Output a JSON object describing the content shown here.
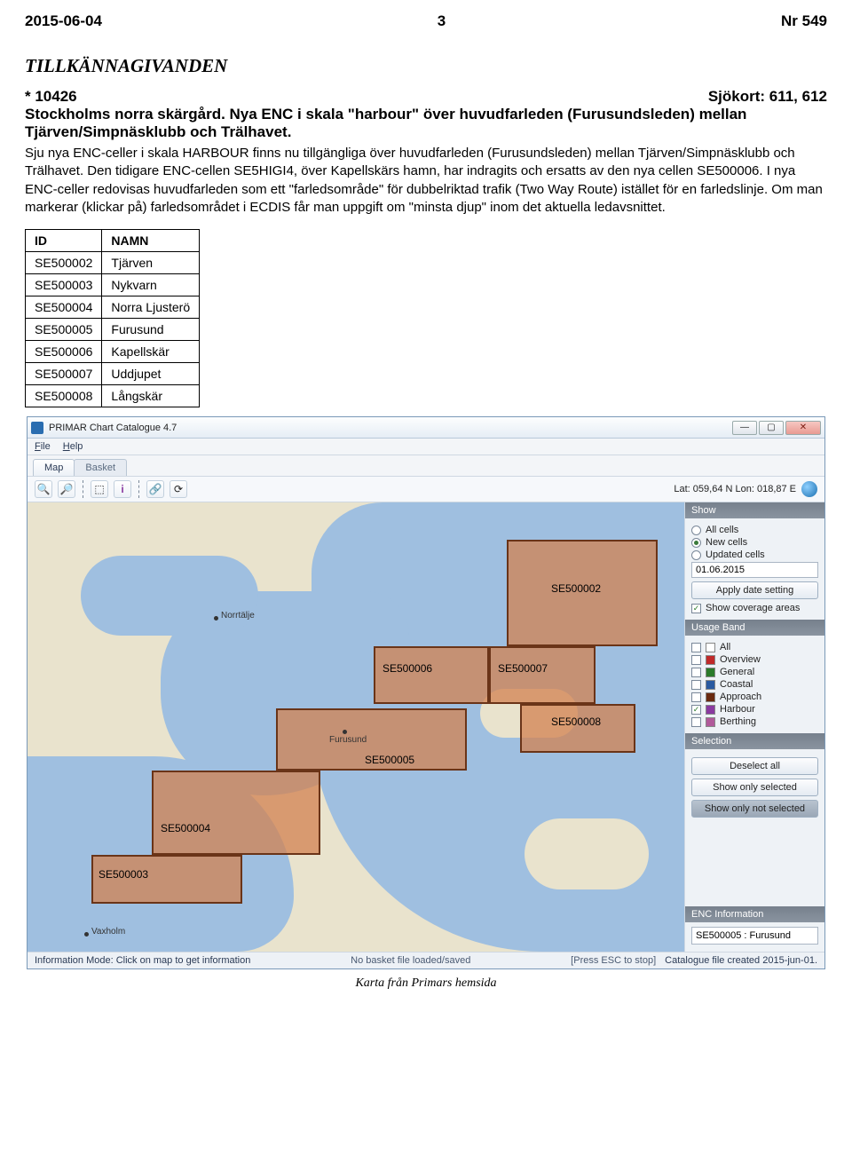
{
  "header": {
    "date": "2015-06-04",
    "page": "3",
    "issue": "Nr 549"
  },
  "section_title": "TILLKÄNNAGIVANDEN",
  "notice": {
    "id": "* 10426",
    "chart_ref": "Sjökort: 611, 612",
    "subtitle": "Stockholms norra skärgård. Nya ENC i skala \"harbour\" över huvudfarleden (Furusundsleden) mellan Tjärven/Simpnäsklubb och Trälhavet.",
    "body": "Sju nya ENC-celler i skala HARBOUR finns nu tillgängliga över huvudfarleden (Furusundsleden) mellan Tjärven/Simpnäsklubb och Trälhavet. Den tidigare ENC-cellen SE5HIGI4, över Kapellskärs hamn, har indragits och ersatts av den nya cellen SE500006. I nya ENC-celler redovisas huvudfarleden som ett \"farledsområde\" för dubbelriktad trafik (Two Way Route) istället för en farledslinje. Om man markerar (klickar på) farledsområdet i ECDIS får man uppgift om \"minsta djup\" inom det aktuella ledavsnittet."
  },
  "table": {
    "headers": [
      "ID",
      "NAMN"
    ],
    "rows": [
      [
        "SE500002",
        "Tjärven"
      ],
      [
        "SE500003",
        "Nykvarn"
      ],
      [
        "SE500004",
        "Norra Ljusterö"
      ],
      [
        "SE500005",
        "Furusund"
      ],
      [
        "SE500006",
        "Kapellskär"
      ],
      [
        "SE500007",
        "Uddjupet"
      ],
      [
        "SE500008",
        "Långskär"
      ]
    ]
  },
  "app": {
    "title": "PRIMAR Chart Catalogue 4.7",
    "menu": {
      "file": "File",
      "help": "Help"
    },
    "tabs": {
      "map": "Map",
      "basket": "Basket"
    },
    "latlon": "Lat:  059,64 N    Lon: 018,87 E",
    "panels": {
      "show": {
        "title": "Show",
        "all": "All cells",
        "new": "New cells",
        "updated": "Updated cells",
        "date": "01.06.2015",
        "apply": "Apply date setting",
        "coverage": "Show coverage areas"
      },
      "usage": {
        "title": "Usage Band",
        "items": [
          {
            "label": "All",
            "color": "#ffffff"
          },
          {
            "label": "Overview",
            "color": "#c02a2a"
          },
          {
            "label": "General",
            "color": "#2a7a2a"
          },
          {
            "label": "Coastal",
            "color": "#2a5aa0"
          },
          {
            "label": "Approach",
            "color": "#6a2a10"
          },
          {
            "label": "Harbour",
            "color": "#8a3aa0"
          },
          {
            "label": "Berthing",
            "color": "#b05a9a"
          }
        ]
      },
      "selection": {
        "title": "Selection",
        "deselect": "Deselect all",
        "only_sel": "Show only selected",
        "only_not": "Show only not selected"
      },
      "enc": {
        "title": "ENC Information",
        "value": "SE500005 : Furusund"
      }
    },
    "status": {
      "left": "Information Mode: Click on map to get information",
      "mid": "No basket file loaded/saved",
      "right_hint": "[Press ESC to stop]",
      "right": "Catalogue file created 2015-jun-01."
    },
    "map_labels": {
      "norrtalje": "Norrtälje",
      "furusund": "Furusund",
      "vaxholm": "Vaxholm"
    }
  },
  "caption": "Karta från Primars hemsida"
}
